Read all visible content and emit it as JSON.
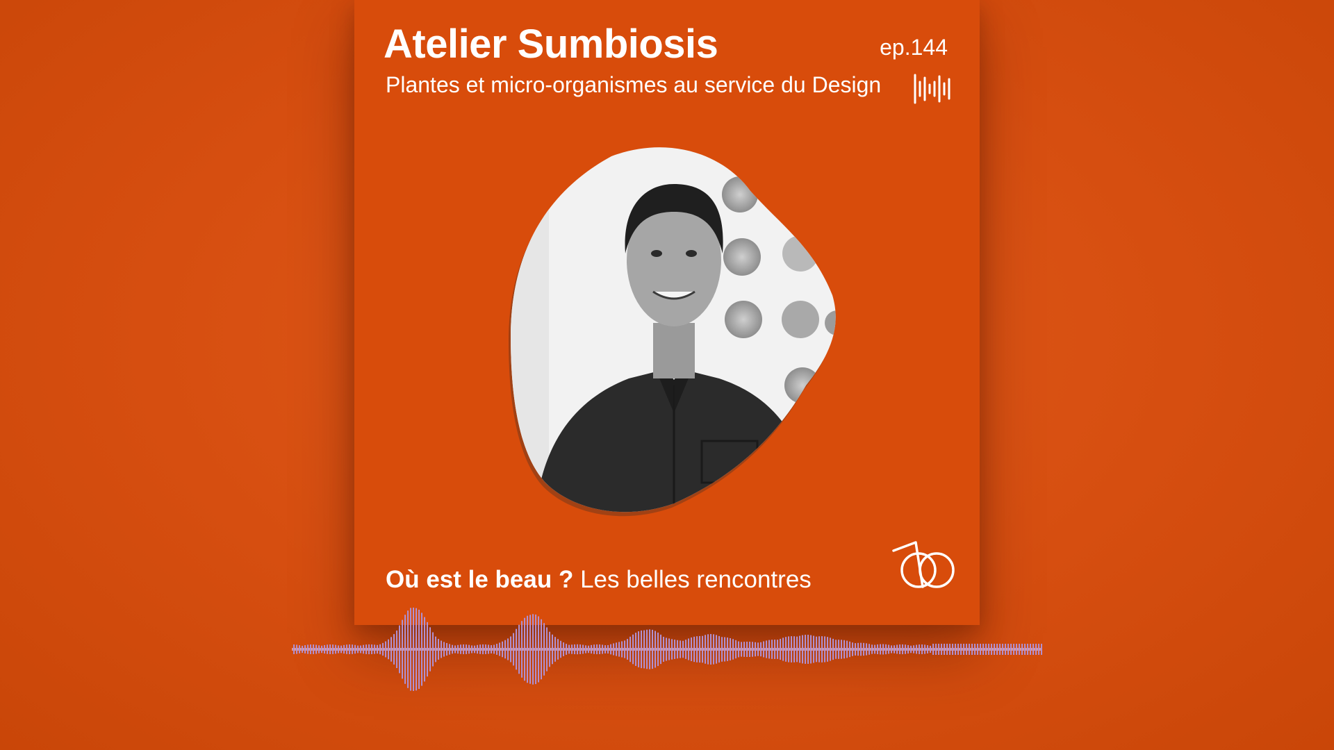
{
  "podcast": {
    "title": "Atelier Sumbiosis",
    "episode": "ep.144",
    "subtitle": "Plantes et micro-organismes au service du Design",
    "tagline_bold": "Où est le beau ?",
    "tagline_regular": "Les belles rencontres"
  },
  "colors": {
    "background": "#d64e10",
    "card": "#d84c0b",
    "text": "#ffffff"
  },
  "icons": {
    "sound": "sound-wave-icon",
    "brand": "ob-logo",
    "photo": "portrait-photo"
  },
  "audio_waveform": {
    "gradient": [
      "#7f86c8",
      "#c58ad2",
      "#d8a0d8",
      "#8c90c8"
    ]
  }
}
